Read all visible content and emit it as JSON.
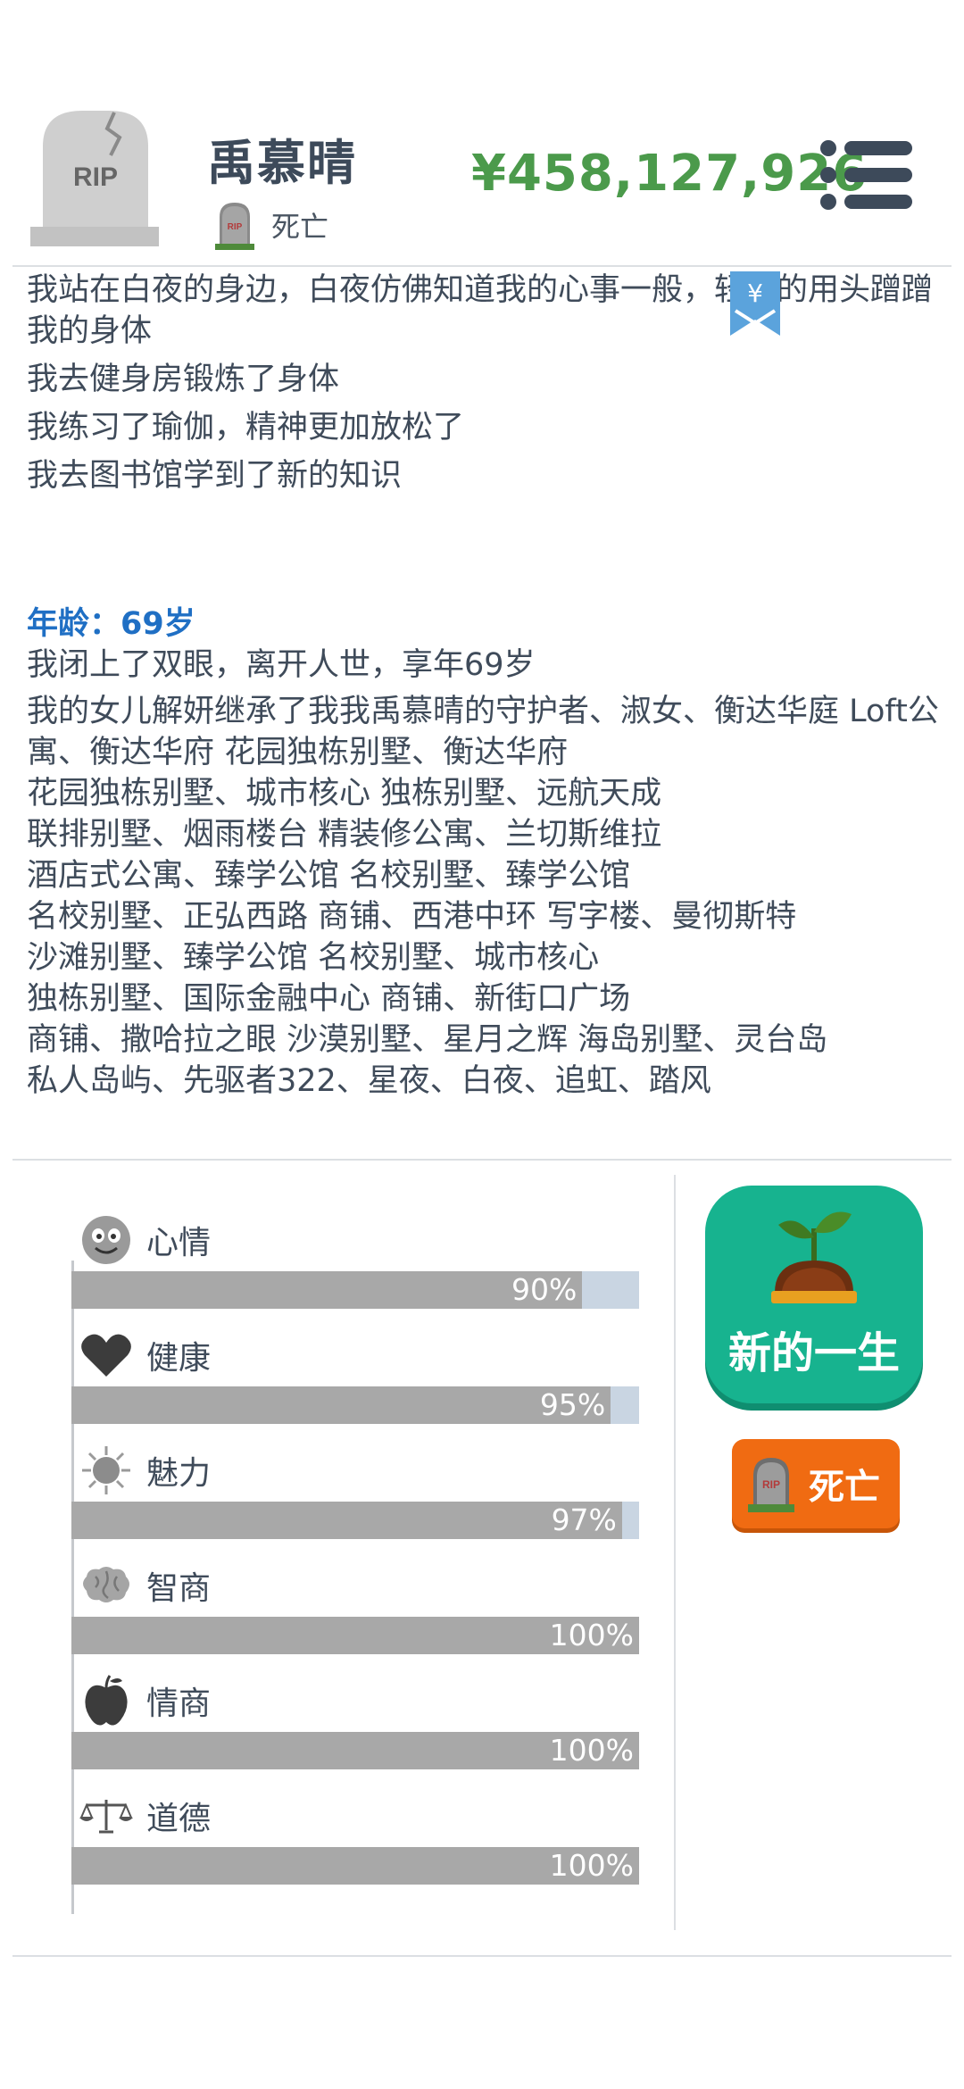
{
  "header": {
    "name": "禹慕晴",
    "status": "死亡",
    "money": "¥458,127,926",
    "avatar_icon": "tombstone-rip-icon",
    "avatar_text": "RIP",
    "menu_icon": "list-menu-icon"
  },
  "log": {
    "lines": [
      "我站在白夜的身边，白夜仿佛知道我的心事一般，轻轻的用头蹭蹭我的身体",
      "我去健身房锻炼了身体",
      "我练习了瑜伽，精神更加放松了",
      "我去图书馆学到了新的知识"
    ],
    "bookmark_icon": "yen-bookmark-icon",
    "bookmark_symbol": "¥"
  },
  "age_section": {
    "heading": "年龄：69岁",
    "death_line": "我闭上了双眼，离开人世，享年69岁",
    "inheritance": "我的女儿解妍继承了我我禹慕晴的守护者、淑女、衡达华庭 Loft公寓、衡达华府 花园独栋别墅、衡达华府\n花园独栋别墅、城市核心 独栋别墅、远航天成\n联排别墅、烟雨楼台 精装修公寓、兰切斯维拉\n酒店式公寓、臻学公馆 名校别墅、臻学公馆\n名校别墅、正弘西路 商铺、西港中环 写字楼、曼彻斯特\n沙滩别墅、臻学公馆 名校别墅、城市核心\n独栋别墅、国际金融中心 商铺、新街口广场\n商铺、撒哈拉之眼 沙漠别墅、星月之辉 海岛别墅、灵台岛\n私人岛屿、先驱者322、星夜、白夜、追虹、踏风"
  },
  "stats": [
    {
      "label": "心情",
      "value": 90,
      "pct": "90%",
      "icon": "smiley-face-icon"
    },
    {
      "label": "健康",
      "value": 95,
      "pct": "95%",
      "icon": "heart-icon"
    },
    {
      "label": "魅力",
      "value": 97,
      "pct": "97%",
      "icon": "sun-icon"
    },
    {
      "label": "智商",
      "value": 100,
      "pct": "100%",
      "icon": "brain-icon"
    },
    {
      "label": "情商",
      "value": 100,
      "pct": "100%",
      "icon": "apple-icon"
    },
    {
      "label": "道德",
      "value": 100,
      "pct": "100%",
      "icon": "scales-icon"
    }
  ],
  "actions": {
    "new_life_label": "新的一生",
    "new_life_icon": "sprout-icon",
    "die_label": "死亡",
    "die_icon": "tombstone-icon",
    "tomb_text": "RIP"
  },
  "colors": {
    "money": "#4b9a4b",
    "age_heading": "#1f6fc4",
    "new_life_button": "#17b38f",
    "die_button": "#f06b12",
    "bar_fill": "#a8a8a8",
    "bar_track": "#c9d5e2"
  }
}
